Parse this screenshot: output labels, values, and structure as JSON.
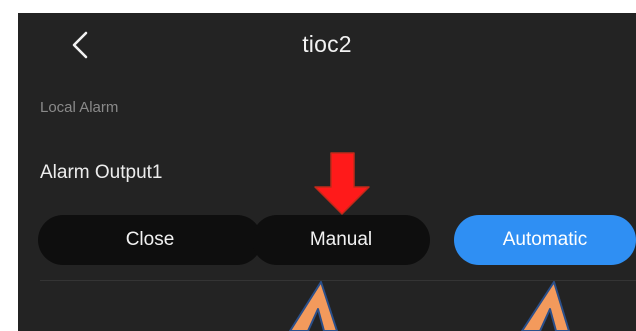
{
  "header": {
    "title": "tioc2",
    "back_icon": "chevron-left-icon"
  },
  "section": {
    "label": "Local Alarm"
  },
  "alarm_output": {
    "label": "Alarm Output1",
    "options": [
      {
        "label": "Close",
        "selected": false
      },
      {
        "label": "Manual",
        "selected": false
      },
      {
        "label": "Automatic",
        "selected": true
      }
    ]
  },
  "colors": {
    "background": "#232323",
    "button": "#0e0e0e",
    "selected_button": "#2f8ff3",
    "annotation_arrow_red": "#ff1a1a",
    "annotation_arrow_orange": "#f39a5c"
  }
}
